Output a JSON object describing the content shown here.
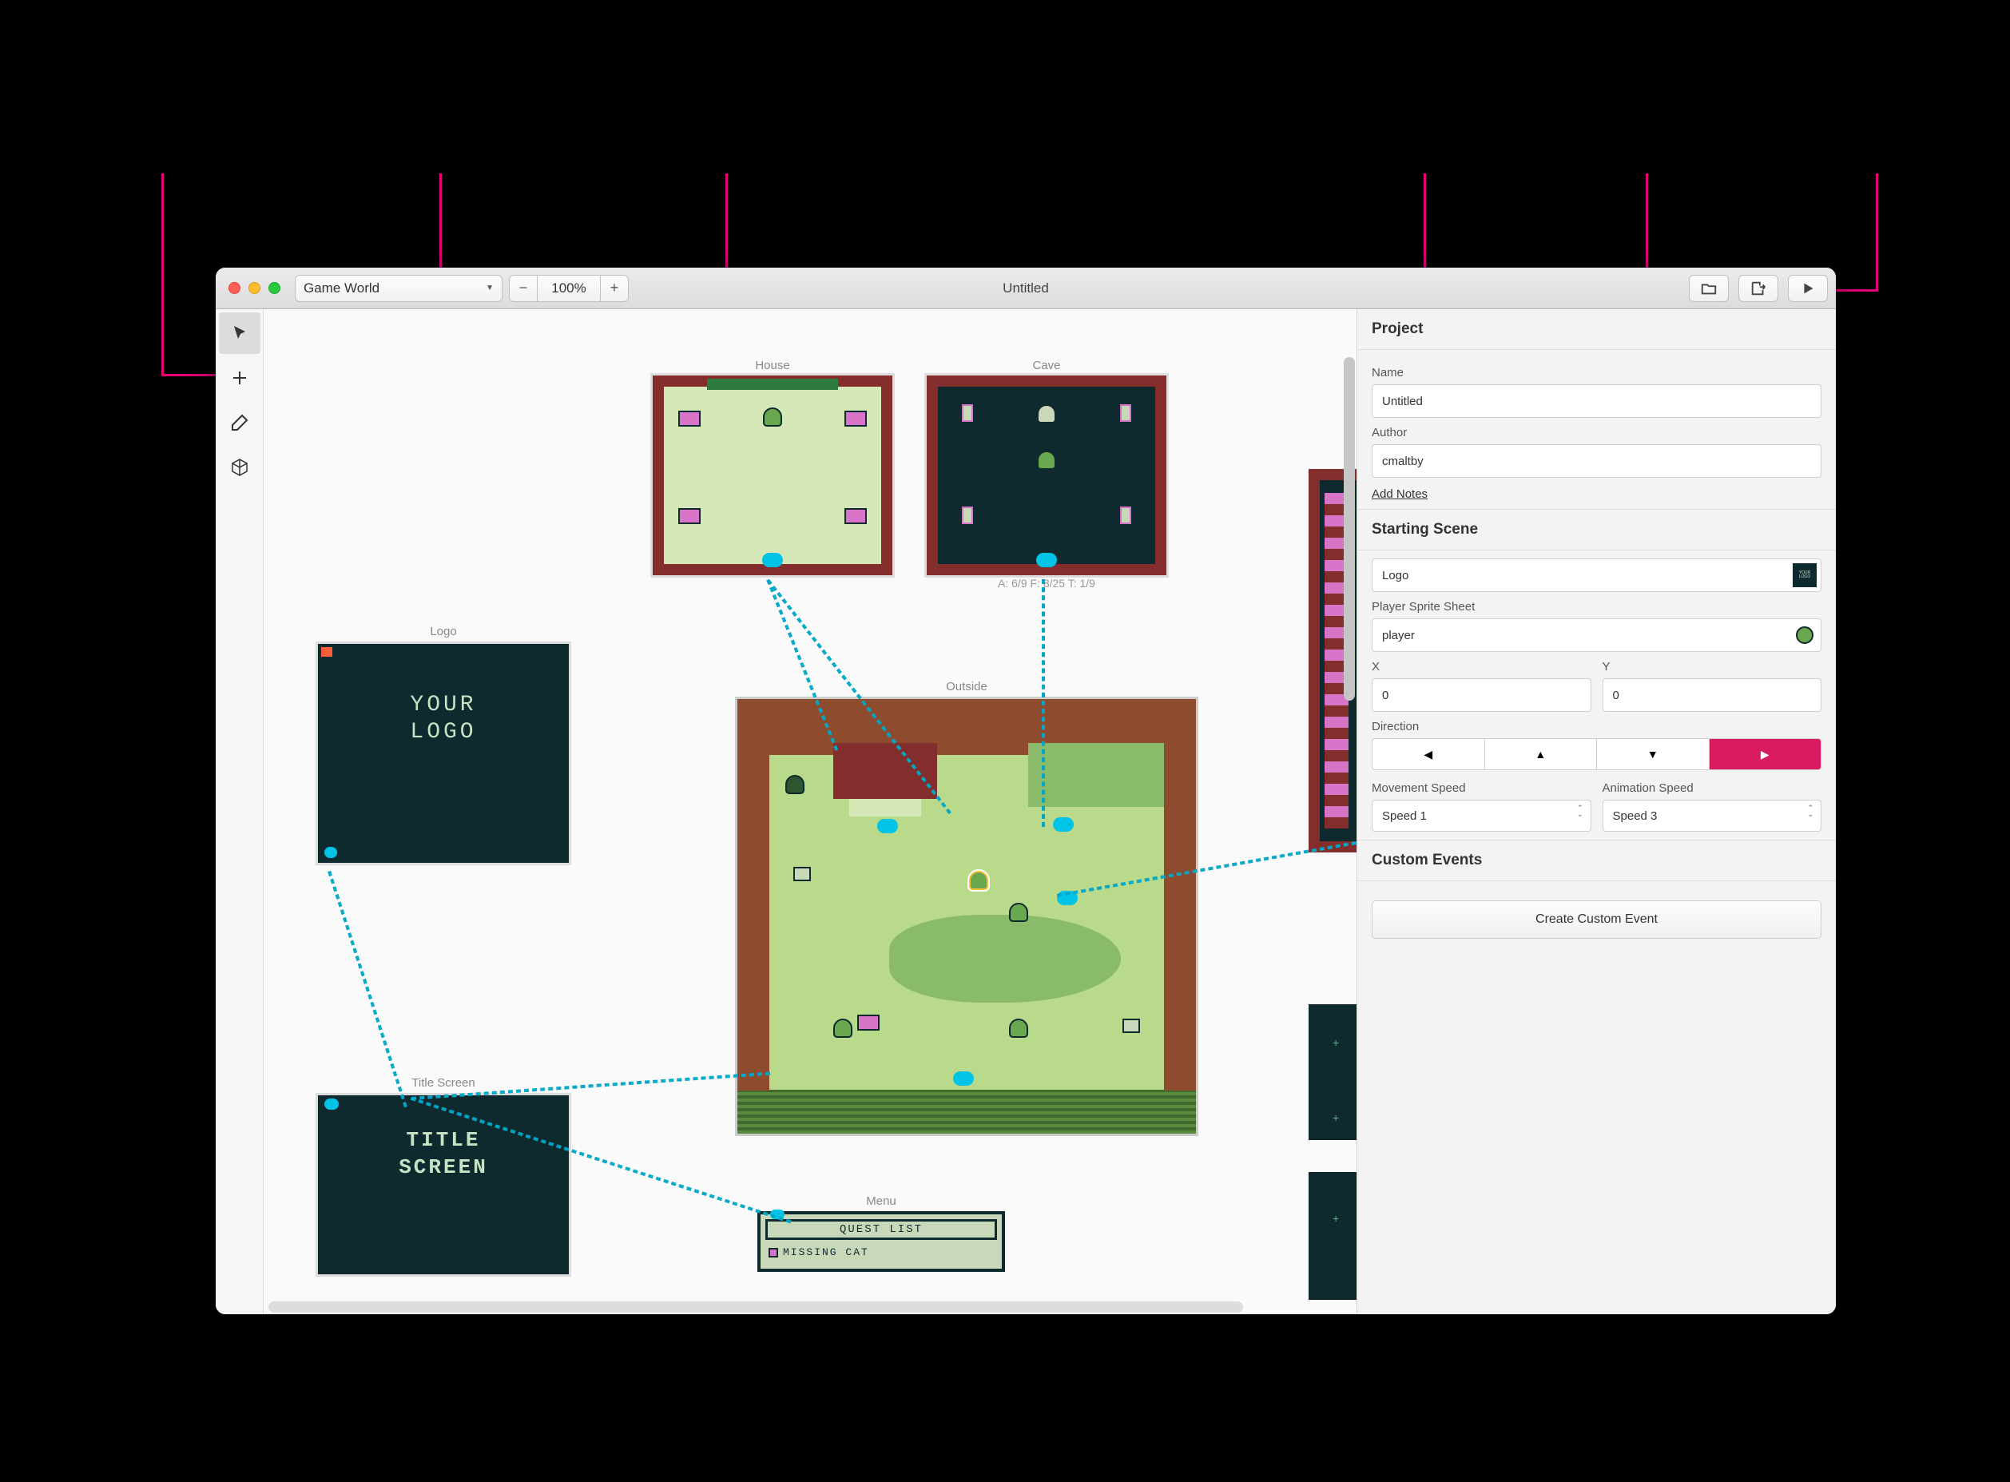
{
  "window_title": "Untitled",
  "editor_select": "Game World",
  "zoom": "100%",
  "scenes": {
    "house": {
      "label": "House"
    },
    "cave": {
      "label": "Cave",
      "stats": "A: 6/9   F: 8/25   T: 1/9"
    },
    "logo": {
      "label": "Logo",
      "line1": "YOUR",
      "line2": "LOGO"
    },
    "outside": {
      "label": "Outside"
    },
    "title": {
      "label": "Title Screen",
      "line1": "TITLE",
      "line2": "SCREEN"
    },
    "menu": {
      "label": "Menu",
      "header": "QUEST LIST",
      "item1": "MISSING CAT"
    }
  },
  "sidebar": {
    "project_header": "Project",
    "name_label": "Name",
    "name_value": "Untitled",
    "author_label": "Author",
    "author_value": "cmaltby",
    "add_notes": "Add Notes",
    "starting_scene_header": "Starting Scene",
    "starting_scene_value": "Logo",
    "sprite_label": "Player Sprite Sheet",
    "sprite_value": "player",
    "x_label": "X",
    "x_value": "0",
    "y_label": "Y",
    "y_value": "0",
    "direction_label": "Direction",
    "dir_left": "◀",
    "dir_up": "▲",
    "dir_down": "▼",
    "dir_right": "▶",
    "move_speed_label": "Movement Speed",
    "move_speed_value": "Speed 1",
    "anim_speed_label": "Animation Speed",
    "anim_speed_value": "Speed 3",
    "custom_events_header": "Custom Events",
    "create_event_btn": "Create Custom Event"
  },
  "thumb_logo": "YOUR LOGO"
}
